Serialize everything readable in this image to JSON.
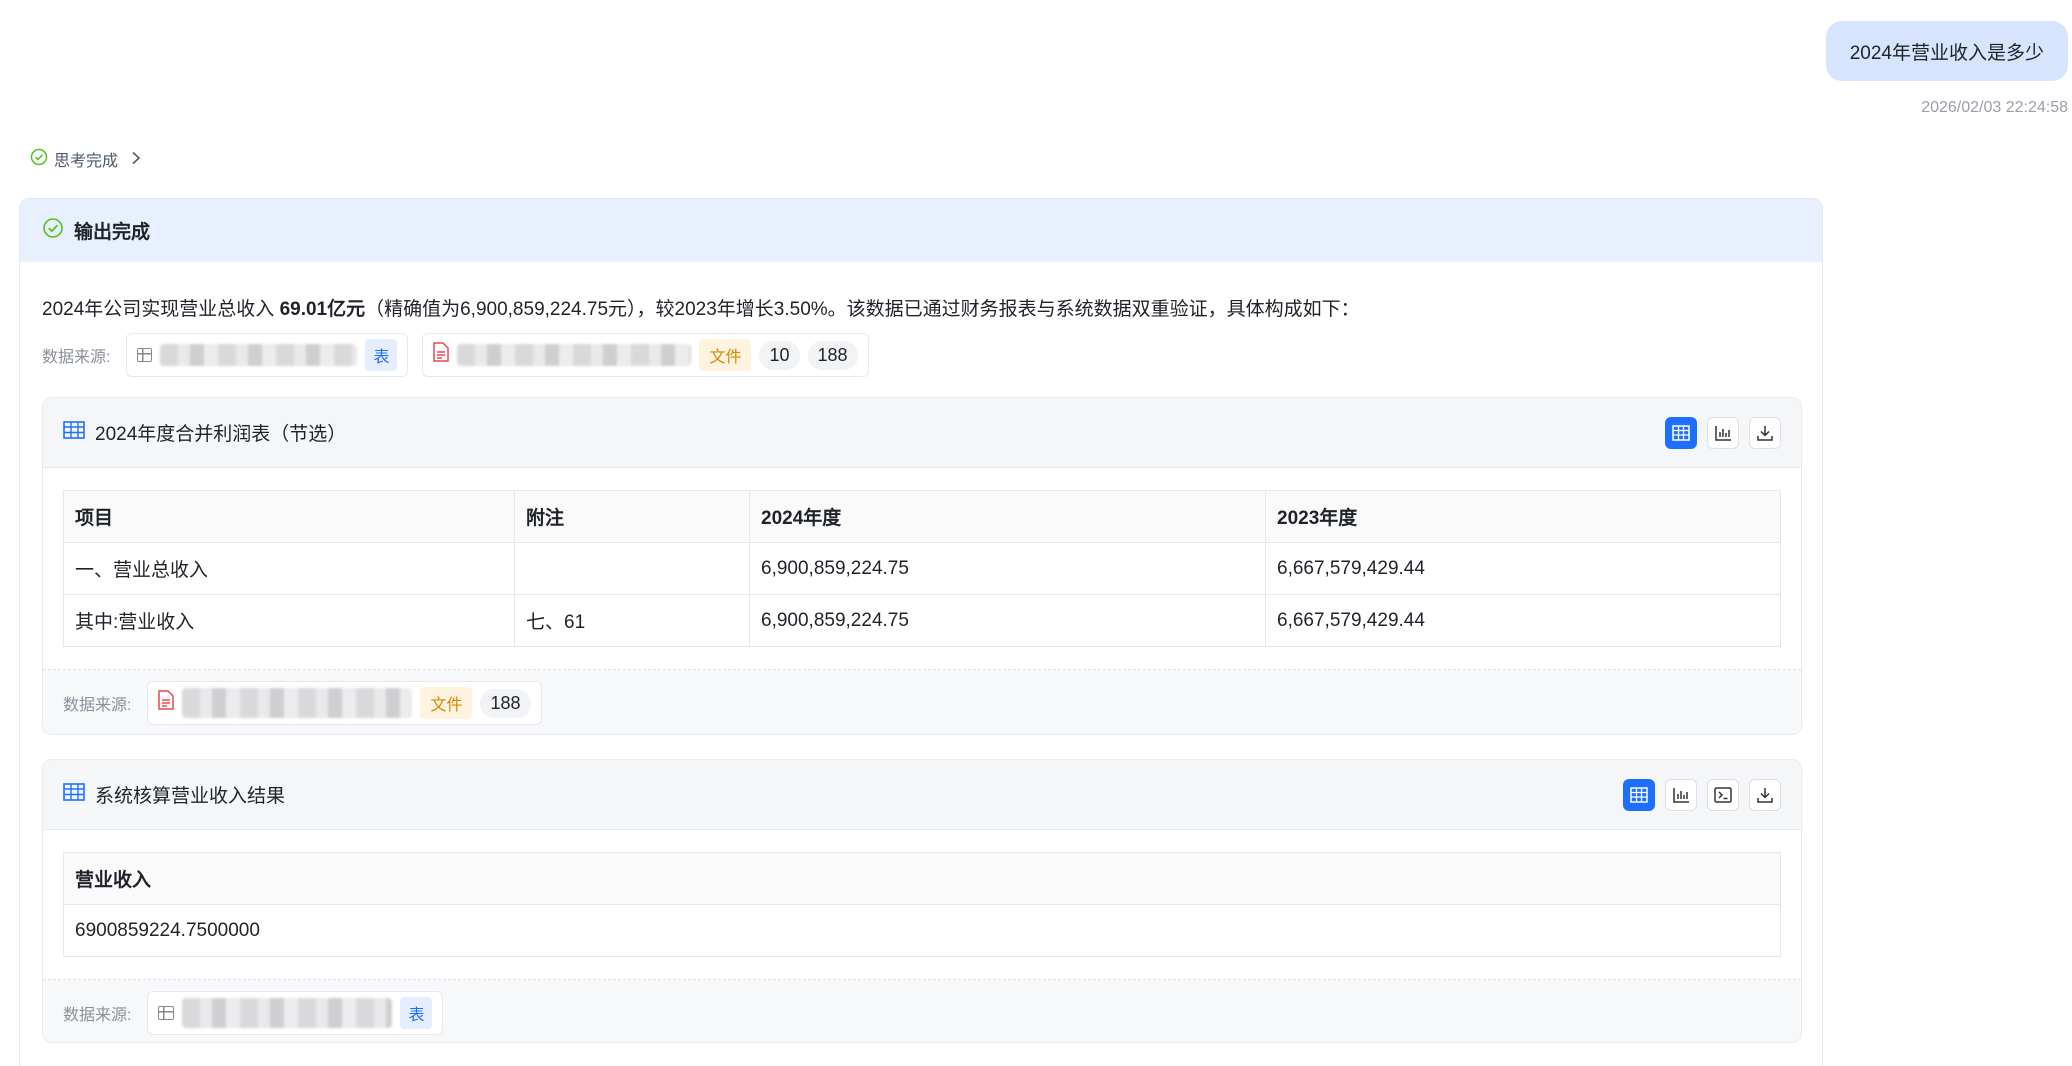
{
  "user": {
    "message": "2024年营业收入是多少",
    "time": "2026/02/03 22:24:58"
  },
  "think": {
    "label": "思考完成"
  },
  "card": {
    "title": "输出完成",
    "summary_pre": "2024年公司实现营业总收入 ",
    "summary_bold": "69.01亿元",
    "summary_post": "（精确值为6,900,859,224.75元），较2023年增长3.50%。该数据已通过财务报表与系统数据双重验证，具体构成如下："
  },
  "sources_top": {
    "label": "数据来源:",
    "chip1_tag": "表",
    "chip2_tag": "文件",
    "chip2_num1": "10",
    "chip2_num2": "188"
  },
  "section1": {
    "title": "2024年度合并利润表（节选）",
    "columns": [
      "项目",
      "附注",
      "2024年度",
      "2023年度"
    ],
    "rows": [
      [
        "一、营业总收入",
        "",
        "6,900,859,224.75",
        "6,667,579,429.44"
      ],
      [
        "其中:营业收入",
        "七、61",
        "6,900,859,224.75",
        "6,667,579,429.44"
      ]
    ],
    "source_label": "数据来源:",
    "source_tag": "文件",
    "source_num": "188"
  },
  "section2": {
    "title": "系统核算营业收入结果",
    "columns": [
      "营业收入"
    ],
    "rows": [
      [
        "6900859224.7500000"
      ]
    ],
    "source_label": "数据来源:",
    "source_tag": "表"
  },
  "colors": {
    "accent": "#1f6fff",
    "success": "#52c41a",
    "file": "#e5484d"
  }
}
